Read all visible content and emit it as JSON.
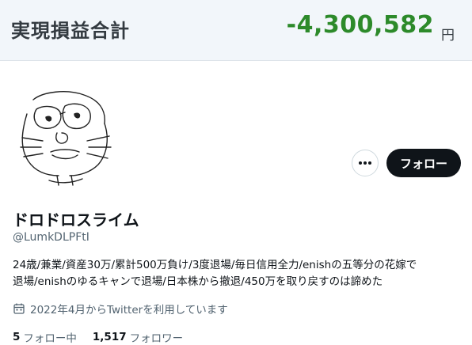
{
  "banner": {
    "label": "実現損益合計",
    "value": "-4,300,582",
    "unit": "円",
    "value_color": "#2d8a2a"
  },
  "profile": {
    "display_name": "ドロドロスライム",
    "handle": "@LumkDLPFtI",
    "bio_lines": [
      "24歳/兼業/資産30万/累計500万負け/3度退場/毎日信用全力/enishの五等分の花嫁で",
      "退場/enishのゆるキャンで退場/日本株から撤退/450万を取り戻すのは諦めた"
    ],
    "joined": "2022年4月からTwitterを利用しています",
    "joined_icon": "calendar-icon",
    "avatar_icon": "hand-drawn-face-avatar"
  },
  "actions": {
    "more_icon": "more-dots-icon",
    "follow_label": "フォロー"
  },
  "stats": {
    "following_count": "5",
    "following_label": "フォロー中",
    "followers_count": "1,517",
    "followers_label": "フォロワー"
  }
}
